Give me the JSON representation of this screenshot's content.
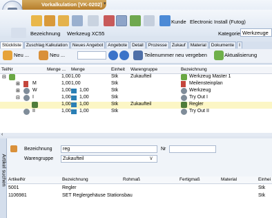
{
  "window": {
    "title": "Vorkalkulation [VK-0202]",
    "quick_access": "▾"
  },
  "header": {
    "kunde_label": "Kunde",
    "kunde_value": "Electronic Install (Futog)",
    "bezeichnung_label": "Bezeichnung",
    "bezeichnung_value": "Werkzeug XC55",
    "kategorie_label": "Kategorie",
    "kategorie_value": "Werkzeuge"
  },
  "tabs": [
    "Stückliste",
    "Zuschlag Kalkulation",
    "Neues Angebot",
    "Angebote",
    "Detail",
    "Prozesse",
    "Zukauf",
    "Material",
    "Dokumente",
    "I"
  ],
  "subtoolbar": {
    "neu1": "Neu ...",
    "neu2": "Neu ...",
    "teilenummer": "Teilenummer neu vergeben",
    "aktualisierung": "Aktualisierung"
  },
  "tree": {
    "columns": [
      "TeilNr",
      "Menge ...",
      "Menge",
      "Einheit",
      "Warengruppe",
      "Bezeichnung"
    ],
    "rows": [
      {
        "teilnr": "",
        "menge_a": "1,00",
        "menge": "1,00",
        "einheit": "Stk",
        "warengruppe": "Zukaufteil",
        "bezeichnung": "Werkzeug Master 1"
      },
      {
        "teilnr": "M",
        "menge_a": "1,00",
        "menge": "1,00",
        "einheit": "Stk",
        "warengruppe": "",
        "bezeichnung": "Meilensteinplan"
      },
      {
        "teilnr": "W",
        "menge_a": "1,00",
        "menge": "1,00",
        "einheit": "Stk",
        "warengruppe": "",
        "bezeichnung": "Werkzeug"
      },
      {
        "teilnr": "I",
        "menge_a": "1,00",
        "menge": "1,00",
        "einheit": "Stk",
        "warengruppe": "",
        "bezeichnung": "Try Out I"
      },
      {
        "teilnr": "",
        "menge_a": "1,00",
        "menge": "1,00",
        "einheit": "Stk",
        "warengruppe": "Zukaufteil",
        "bezeichnung": "Regler"
      },
      {
        "teilnr": "II",
        "menge_a": "1,00",
        "menge": "1,00",
        "einheit": "Stk",
        "warengruppe": "",
        "bezeichnung": "Try Out II"
      }
    ]
  },
  "search": {
    "vtab_label": "Artikel suchen",
    "bezeichnung_label": "Bezeichnung",
    "bezeichnung_value": "reg",
    "nr_label": "Nr",
    "warengruppe_label": "Warengruppe",
    "warengruppe_value": "Zukaufteil",
    "columns": [
      "ArtikelNr",
      "Bezeichnung",
      "Rohmaß",
      "Fertigmaß",
      "Material",
      "Einhei"
    ],
    "rows": [
      {
        "artikelnr": "5001",
        "bezeichnung": "Regler",
        "einheit": "Stk"
      },
      {
        "artikelnr": "1106981",
        "bezeichnung": "SET Reglergehäuse Stationsbau",
        "einheit": "Stk"
      }
    ]
  },
  "colors": {
    "title_tab": "#c48f3f",
    "selected_row": "#fcf6c5"
  }
}
